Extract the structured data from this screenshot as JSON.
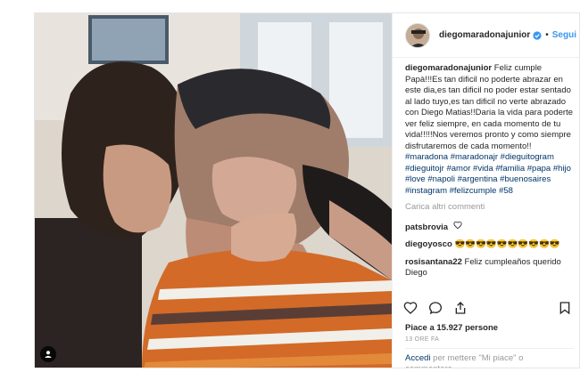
{
  "post": {
    "username": "diegomaradonajunior",
    "follow_label": "Segui",
    "dot": "•"
  },
  "caption": {
    "username": "diegomaradonajunior",
    "text": "Feliz cumple Papà!!!Es tan dificil no poderte abrazar en este dia,es tan dificil no poder estar sentado al lado tuyo,es tan dificil no verte abrazado con Diego Matias!!Daria la vida para poderte ver feliz siempre, en cada momento de tu vida!!!!!Nos veremos pronto y como siempre disfrutaremos de cada momento!!",
    "hashtags": "#maradona #maradonajr #dieguitogram #dieguitojr #amor #vida #familia #papa #hijo #love #napoli #argentina #buenosaires #instagram #felizcumple #58"
  },
  "load_more": "Carica altri commenti",
  "comments": [
    {
      "username": "patsbrovia",
      "text": ""
    },
    {
      "username": "diegoyosco",
      "text": "😎😎😎😎😎😎😎😎😎😎"
    },
    {
      "username": "rosisantana22",
      "text": "Feliz cumpleaños querido Diego"
    }
  ],
  "likes_text": "Piace a 15.927 persone",
  "time_ago": "13 ORE FA",
  "add_comment": {
    "login_link": "Accedi",
    "rest": " per mettere \"Mi piace\" o commentare."
  },
  "icons": {
    "verified": "verified-badge-icon",
    "user_tag": "user-tag-icon",
    "like": "heart-icon",
    "comment": "comment-bubble-icon",
    "share": "share-icon",
    "save": "bookmark-icon"
  },
  "colors": {
    "link_blue": "#3897f0",
    "hashtag": "#003569",
    "muted": "#999999"
  }
}
